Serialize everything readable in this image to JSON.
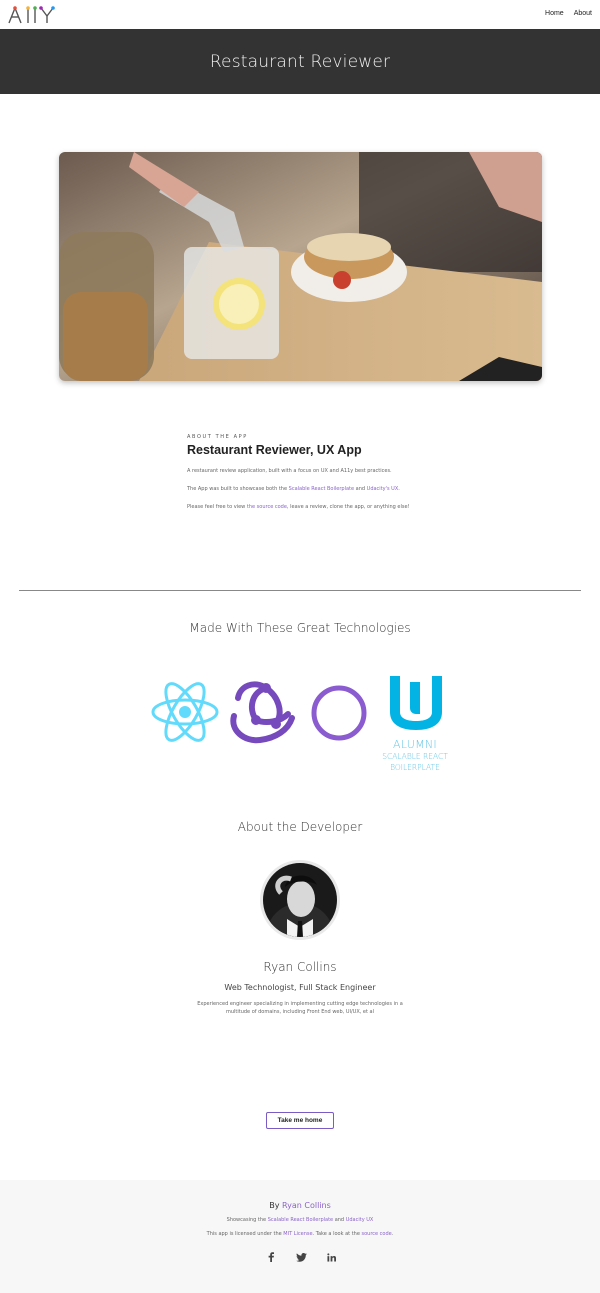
{
  "nav": {
    "logo_text": "A11Y",
    "links": [
      "Home",
      "About"
    ]
  },
  "banner": {
    "title": "Restaurant Reviewer"
  },
  "about": {
    "eyebrow": "ABOUT THE APP",
    "heading": "Restaurant Reviewer, UX App",
    "p1": "A restaurant review application, built with a focus on UX and A11y best practices.",
    "p2_prefix": "The App was built to showcase both the ",
    "p2_link1": "Scalable React Boilerplate",
    "p2_mid": " and ",
    "p2_link2": "Udacity's UX",
    "p2_suffix": ".",
    "p3_prefix": "Please feel free to view ",
    "p3_link": "the source code",
    "p3_suffix": ", leave a review, clone the app, or anything else!"
  },
  "techs": {
    "title": "Made With These Great Technologies",
    "icons": [
      "react-icon",
      "redux-icon",
      "circle-icon",
      "udacity-icon"
    ],
    "udacity_alumni": "ALUMNI",
    "udacity_sub1": "SCALABLE REACT",
    "udacity_sub2": "BOILERPLATE",
    "colors": {
      "react": "#61dafb",
      "redux": "#764abc",
      "circle": "#8a5cd0",
      "udacity": "#02b3e4"
    }
  },
  "developer": {
    "title": "About the Developer",
    "name": "Ryan Collins",
    "role": "Web Technologist, Full Stack Engineer",
    "bio": "Experienced engineer specializing in implementing cutting edge technologies in a multitude of domains, including Front End web, UI/UX, et al"
  },
  "home_button": "Take me home",
  "footer": {
    "by_prefix": "By ",
    "by_link": "Ryan Collins",
    "l2_prefix": "Showcasing the ",
    "l2_link1": "Scalable React Boilerplate",
    "l2_mid": " and ",
    "l2_link2": "Udacity UX",
    "l3_prefix": "This app is licensed under the ",
    "l3_link1": "MIT License",
    "l3_mid": ". Take a look at the ",
    "l3_link2": "source code",
    "l3_suffix": ".",
    "socials": [
      "facebook-icon",
      "twitter-icon",
      "linkedin-icon"
    ]
  }
}
